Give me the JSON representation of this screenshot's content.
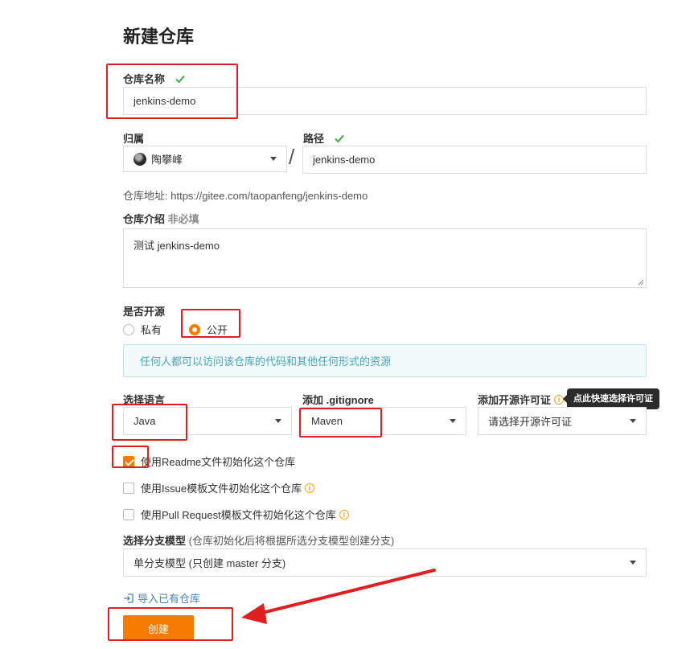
{
  "page": {
    "title": "新建仓库"
  },
  "repo_name": {
    "label": "仓库名称",
    "value": "jenkins-demo"
  },
  "owner": {
    "label": "归属",
    "value": "陶攀峰"
  },
  "separator": "/",
  "path": {
    "label": "路径",
    "value": "jenkins-demo"
  },
  "repo_url": {
    "label": "仓库地址:",
    "value": "https://gitee.com/taopanfeng/jenkins-demo"
  },
  "description": {
    "label": "仓库介绍",
    "optional": "非必填",
    "value": "测试 jenkins-demo"
  },
  "visibility": {
    "label": "是否开源",
    "options": [
      {
        "label": "私有",
        "checked": false
      },
      {
        "label": "公开",
        "checked": true
      }
    ],
    "info": "任何人都可以访问该仓库的代码和其他任何形式的资源"
  },
  "language": {
    "label": "选择语言",
    "value": "Java"
  },
  "gitignore": {
    "label": "添加 .gitignore",
    "value": "Maven"
  },
  "license": {
    "label": "添加开源许可证",
    "placeholder": "请选择开源许可证",
    "tooltip": "点此快速选择许可证"
  },
  "init_options": [
    {
      "label": "使用Readme文件初始化这个仓库",
      "checked": true,
      "info": false
    },
    {
      "label": "使用Issue模板文件初始化这个仓库",
      "checked": false,
      "info": true
    },
    {
      "label": "使用Pull Request模板文件初始化这个仓库",
      "checked": false,
      "info": true
    }
  ],
  "branch_model": {
    "label": "选择分支模型",
    "hint": "(仓库初始化后将根据所选分支模型创建分支)",
    "value": "单分支模型 (只创建 master 分支)"
  },
  "import_link": "导入已有仓库",
  "create_button": "创建",
  "colors": {
    "accent": "#f57c00",
    "annotation": "#e02020",
    "check": "#4caf50",
    "info_text": "#4ba3b5"
  }
}
